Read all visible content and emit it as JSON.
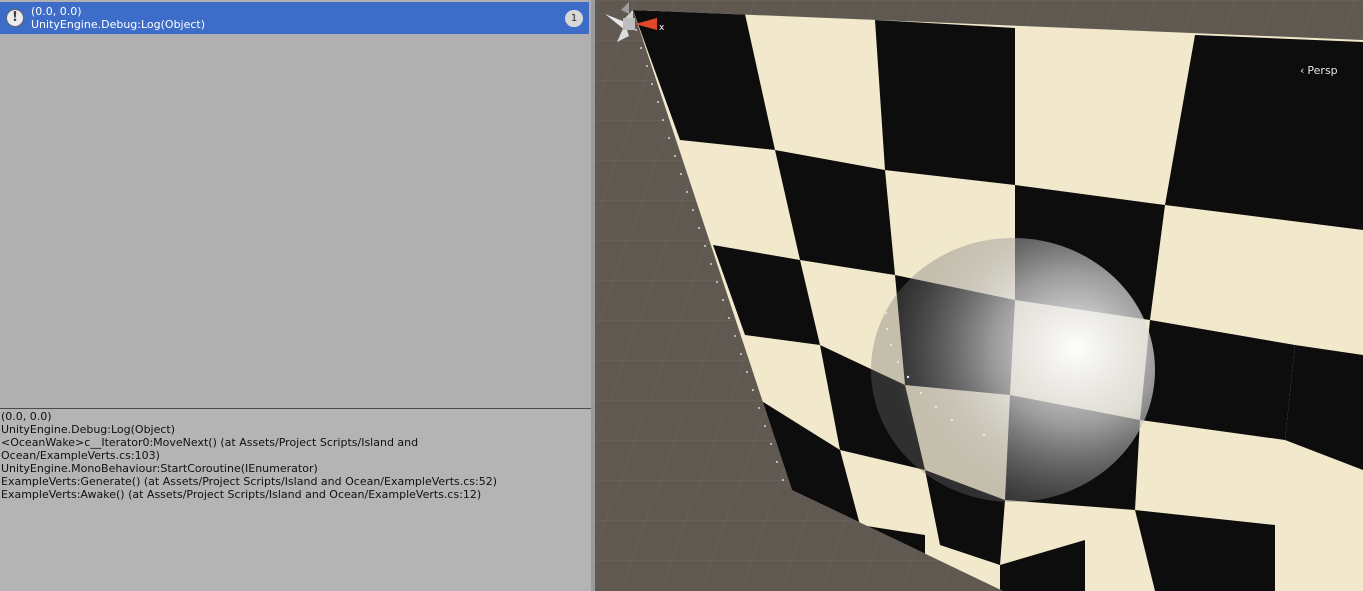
{
  "console": {
    "entry": {
      "icon": "warning-icon",
      "message": "(0.0, 0.0)",
      "source": "UnityEngine.Debug:Log(Object)",
      "count": "1"
    },
    "detail_lines": [
      "(0.0, 0.0)",
      "UnityEngine.Debug:Log(Object)",
      "<OceanWake>c__Iterator0:MoveNext() (at Assets/Project Scripts/Island and",
      "Ocean/ExampleVerts.cs:103)",
      "UnityEngine.MonoBehaviour:StartCoroutine(IEnumerator)",
      "ExampleVerts:Generate() (at Assets/Project Scripts/Island and Ocean/ExampleVerts.cs:52)",
      "ExampleVerts:Awake() (at Assets/Project Scripts/Island and Ocean/ExampleVerts.cs:12)"
    ]
  },
  "scene_view": {
    "projection_label": "Persp",
    "projection_icon": "chevron-left-icon",
    "gizmo": {
      "icon": "orientation-gizmo-icon",
      "axis_label": "x"
    },
    "colors": {
      "selection_blue": "#3d6dc8",
      "checker_light": "#f2e8cb",
      "checker_dark": "#0d0d0d",
      "ground": "#5f5952",
      "gizmo_x": "#e0482c"
    }
  }
}
